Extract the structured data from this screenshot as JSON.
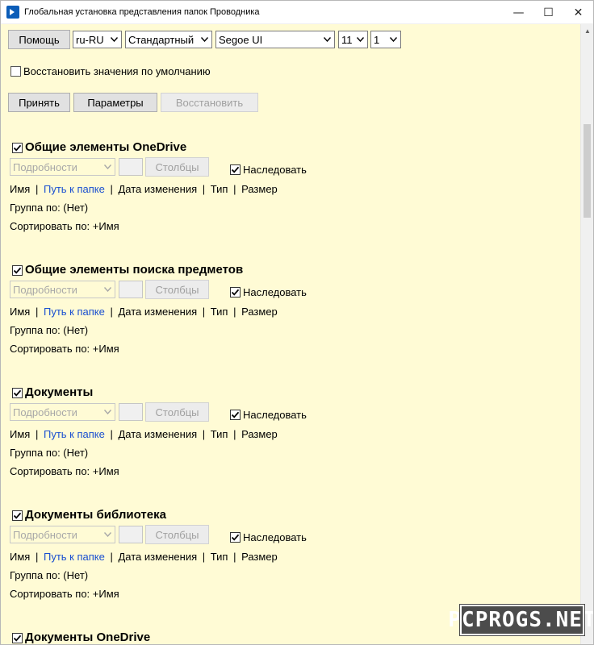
{
  "window": {
    "title": "Глобальная установка представления папок Проводника",
    "controls": {
      "minimize": "—",
      "maximize": "☐",
      "close": "✕"
    }
  },
  "toolbar": {
    "help_label": "Помощь",
    "language": "ru-RU",
    "style": "Стандартный",
    "font": "Segoe UI",
    "font_size": "11",
    "spacing": "1"
  },
  "restore_defaults_label": "Восстановить значения по умолчанию",
  "actions": {
    "apply_label": "Принять",
    "options_label": "Параметры",
    "restore_label": "Восстановить"
  },
  "sections": [
    {
      "title": "Общие элементы OneDrive",
      "view": "Подробности",
      "columns_label": "Столбцы",
      "inherit_label": "Наследовать",
      "cols": {
        "name": "Имя",
        "path": "Путь к папке",
        "date": "Дата изменения",
        "type": "Тип",
        "size": "Размер",
        "sep": "|"
      },
      "group_by": "Группа по: (Нет)",
      "sort_by": "Сортировать по: +Имя"
    },
    {
      "title": "Общие элементы поиска предметов",
      "view": "Подробности",
      "columns_label": "Столбцы",
      "inherit_label": "Наследовать",
      "cols": {
        "name": "Имя",
        "path": "Путь к папке",
        "date": "Дата изменения",
        "type": "Тип",
        "size": "Размер",
        "sep": "|"
      },
      "group_by": "Группа по: (Нет)",
      "sort_by": "Сортировать по: +Имя"
    },
    {
      "title": "Документы",
      "view": "Подробности",
      "columns_label": "Столбцы",
      "inherit_label": "Наследовать",
      "cols": {
        "name": "Имя",
        "path": "Путь к папке",
        "date": "Дата изменения",
        "type": "Тип",
        "size": "Размер",
        "sep": "|"
      },
      "group_by": "Группа по: (Нет)",
      "sort_by": "Сортировать по: +Имя"
    },
    {
      "title": "Документы библиотека",
      "view": "Подробности",
      "columns_label": "Столбцы",
      "inherit_label": "Наследовать",
      "cols": {
        "name": "Имя",
        "path": "Путь к папке",
        "date": "Дата изменения",
        "type": "Тип",
        "size": "Размер",
        "sep": "|"
      },
      "group_by": "Группа по: (Нет)",
      "sort_by": "Сортировать по: +Имя"
    },
    {
      "title": "Документы OneDrive"
    }
  ],
  "watermark": "PCPROGS.NET",
  "colors": {
    "background": "#fffbd5",
    "link": "#1a4fd0",
    "button": "#e1e1e1",
    "disabled_text": "#a0a0a0"
  },
  "icons": {
    "app": "powershell-icon",
    "dropdown": "chevron-down-icon",
    "check": "checkmark-icon"
  }
}
